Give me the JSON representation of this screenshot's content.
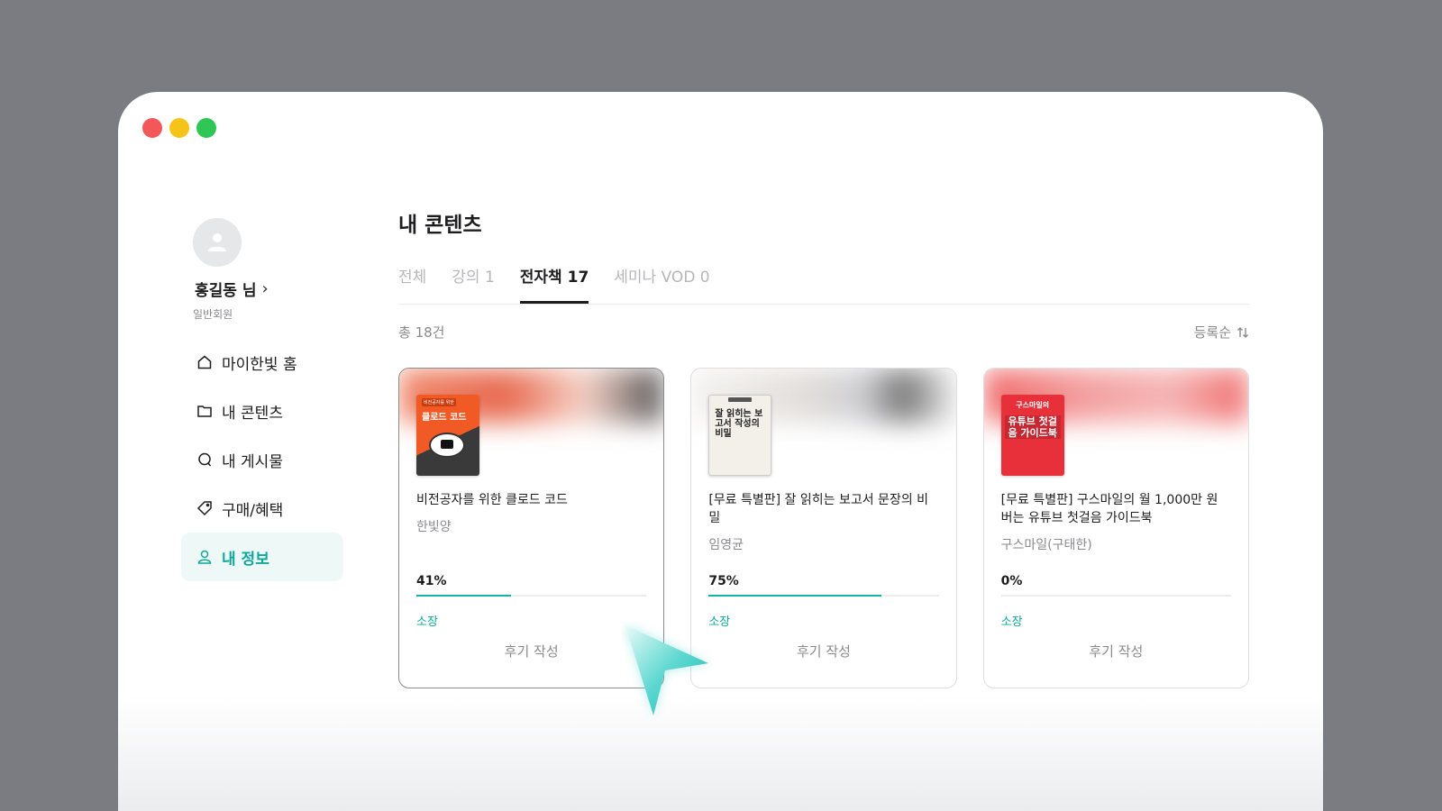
{
  "user": {
    "name": "홍길동 님",
    "grade": "일반회원"
  },
  "sidebar": {
    "items": [
      {
        "label": "마이한빛 홈",
        "icon": "home-icon"
      },
      {
        "label": "내 콘텐츠",
        "icon": "folder-icon"
      },
      {
        "label": "내 게시물",
        "icon": "chat-icon"
      },
      {
        "label": "구매/혜택",
        "icon": "tag-icon"
      },
      {
        "label": "내 정보",
        "icon": "user-icon",
        "active": true
      }
    ]
  },
  "main": {
    "title": "내 콘텐츠",
    "tabs": [
      {
        "label": "전체"
      },
      {
        "label": "강의 1"
      },
      {
        "label": "전자책 17",
        "active": true
      },
      {
        "label": "세미나 VOD 0"
      }
    ],
    "total": "총 18건",
    "sort_label": "등록순"
  },
  "cards": [
    {
      "title": "비전공자를 위한 클로드 코드",
      "author": "한빛양",
      "progress_label": "41%",
      "progress": 0.41,
      "status": "소장",
      "review": "후기 작성",
      "cover_text": "클로드 코드",
      "cover_badge": "비전공자를 위한"
    },
    {
      "title": "[무료 특별판] 잘 읽히는 보고서 문장의 비밀",
      "author": "임영균",
      "progress_label": "75%",
      "progress": 0.75,
      "status": "소장",
      "review": "후기 작성",
      "cover_text": "잘 읽히는 보고서 작성의 비밀"
    },
    {
      "title": "[무료 특별판] 구스마일의 월 1,000만 원 버는 유튜브 첫걸음 가이드북",
      "author": "구스마일(구태한)",
      "progress_label": "0%",
      "progress": 0,
      "status": "소장",
      "review": "후기 작성",
      "cover_text": "유튜브 첫걸음 가이드북",
      "cover_badge": "구스마일의"
    }
  ],
  "colors": {
    "accent": "#14b1a4",
    "frame": "#7b7c81"
  }
}
